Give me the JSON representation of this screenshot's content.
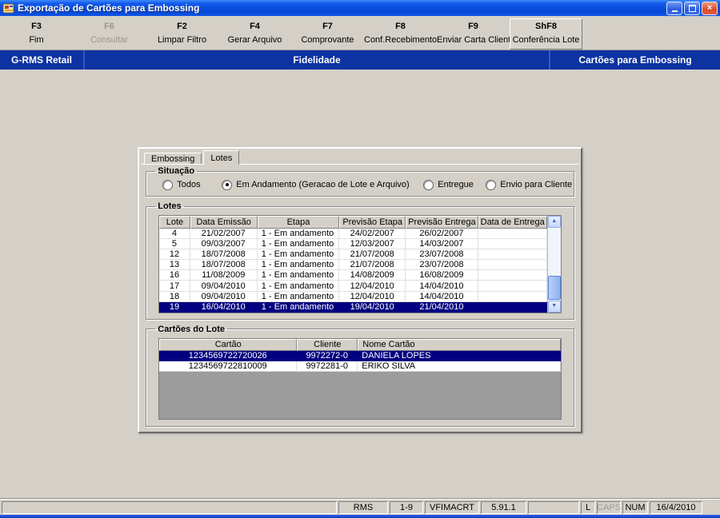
{
  "window": {
    "title": "Exportação de Cartões para Embossing"
  },
  "toolbar": {
    "buttons": [
      {
        "key": "F3",
        "label": "Fim",
        "enabled": true,
        "active": false
      },
      {
        "key": "F6",
        "label": "Consultar",
        "enabled": false,
        "active": false
      },
      {
        "key": "F2",
        "label": "Limpar Filtro",
        "enabled": true,
        "active": false
      },
      {
        "key": "F4",
        "label": "Gerar Arquivo",
        "enabled": true,
        "active": false
      },
      {
        "key": "F7",
        "label": "Comprovante",
        "enabled": true,
        "active": false
      },
      {
        "key": "F8",
        "label": "Conf.Recebimento",
        "enabled": true,
        "active": false
      },
      {
        "key": "F9",
        "label": "Enviar Carta Cliente",
        "enabled": true,
        "active": false
      },
      {
        "key": "ShF8",
        "label": "Conferência Lote",
        "enabled": true,
        "active": true
      }
    ]
  },
  "navbar": {
    "left": "G-RMS Retail",
    "center": "Fidelidade",
    "right": "Cartões para Embossing"
  },
  "panel": {
    "tabs": [
      {
        "label": "Embossing",
        "active": false
      },
      {
        "label": "Lotes",
        "active": true
      }
    ],
    "situacao": {
      "legend": "Situação",
      "options": [
        {
          "label": "Todos",
          "selected": false
        },
        {
          "label": "Em Andamento (Geracao de Lote e Arquivo)",
          "selected": true
        },
        {
          "label": "Entregue",
          "selected": false
        },
        {
          "label": "Envio para Cliente",
          "selected": false
        }
      ]
    },
    "lotes": {
      "legend": "Lotes",
      "columns": [
        "Lote",
        "Data Emissão",
        "Etapa",
        "Previsão Etapa",
        "Previsão Entrega",
        "Data de Entrega"
      ],
      "rows": [
        [
          "4",
          "21/02/2007",
          "1 - Em andamento",
          "24/02/2007",
          "26/02/2007",
          ""
        ],
        [
          "5",
          "09/03/2007",
          "1 - Em andamento",
          "12/03/2007",
          "14/03/2007",
          ""
        ],
        [
          "12",
          "18/07/2008",
          "1 - Em andamento",
          "21/07/2008",
          "23/07/2008",
          ""
        ],
        [
          "13",
          "18/07/2008",
          "1 - Em andamento",
          "21/07/2008",
          "23/07/2008",
          ""
        ],
        [
          "16",
          "11/08/2009",
          "1 - Em andamento",
          "14/08/2009",
          "16/08/2009",
          ""
        ],
        [
          "17",
          "09/04/2010",
          "1 - Em andamento",
          "12/04/2010",
          "14/04/2010",
          ""
        ],
        [
          "18",
          "09/04/2010",
          "1 - Em andamento",
          "12/04/2010",
          "14/04/2010",
          ""
        ],
        [
          "19",
          "16/04/2010",
          "1 - Em andamento",
          "19/04/2010",
          "21/04/2010",
          ""
        ]
      ],
      "selected_row": 7
    },
    "cartoes": {
      "legend": "Cartões do Lote",
      "columns": [
        "Cartão",
        "Cliente",
        "Nome Cartão"
      ],
      "rows": [
        [
          "1234569722720026",
          "9972272-0",
          "DANIELA LOPES"
        ],
        [
          "1234569722810009",
          "9972281-0",
          "ERIKO SILVA"
        ]
      ],
      "selected_row": 0
    }
  },
  "statusbar": {
    "panels": [
      {
        "text": ""
      },
      {
        "text": "RMS"
      },
      {
        "text": "1-9"
      },
      {
        "text": "VFIMACRT"
      },
      {
        "text": "5.91.1"
      },
      {
        "text": ""
      },
      {
        "text": "L"
      },
      {
        "text": "CAPS",
        "disabled": true
      },
      {
        "text": "NUM"
      },
      {
        "text": "16/4/2010"
      }
    ]
  }
}
